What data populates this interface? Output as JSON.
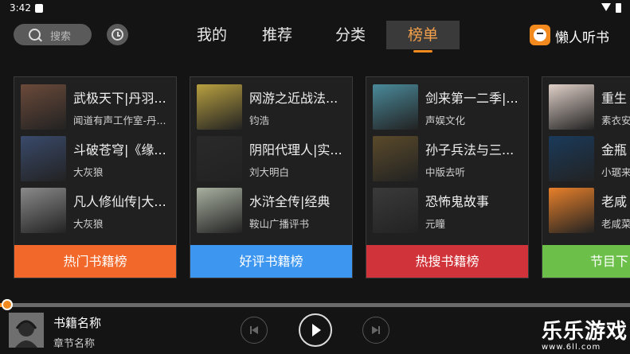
{
  "status_bar": {
    "time": "3:42"
  },
  "header": {
    "search_placeholder": "搜索",
    "tabs": [
      {
        "label": "我的"
      },
      {
        "label": "推荐"
      },
      {
        "label": "分类"
      },
      {
        "label": "榜单",
        "active": true
      }
    ],
    "brand": "懒人听书"
  },
  "cards": [
    {
      "label": "热门书籍榜",
      "color": "#f2682a",
      "items": [
        {
          "title": "武极天下|丹羽...",
          "author": "闻道有声工作室-丹...",
          "cover": "#6b4a3a"
        },
        {
          "title": "斗破苍穹|《缘...",
          "author": "大灰狼",
          "cover": "#3a4a6b"
        },
        {
          "title": "凡人修仙传|大...",
          "author": "大灰狼",
          "cover": "#8a8a8a"
        }
      ]
    },
    {
      "label": "好评书籍榜",
      "color": "#3d97f0",
      "items": [
        {
          "title": "网游之近战法...",
          "author": "钧浩",
          "cover": "#b8a040"
        },
        {
          "title": "阴阳代理人|实...",
          "author": "刘大明白",
          "cover": "#2a2a2a"
        },
        {
          "title": "水浒全传|经典",
          "author": "鞍山广播评书",
          "cover": "#a8b0a0"
        }
      ]
    },
    {
      "label": "热搜书籍榜",
      "color": "#d0343a",
      "items": [
        {
          "title": "剑来第一二季|...",
          "author": "声娱文化",
          "cover": "#4a8a9a"
        },
        {
          "title": "孙子兵法与三...",
          "author": "中版去听",
          "cover": "#5a4a2a"
        },
        {
          "title": "恐怖鬼故事",
          "author": "元瞳",
          "cover": "#3a3a3a"
        }
      ]
    },
    {
      "label": "节目下",
      "color": "#6cc04a",
      "items": [
        {
          "title": "重生",
          "author": "素衣安",
          "cover": "#e0d0c8"
        },
        {
          "title": "金瓶",
          "author": "小琚来",
          "cover": "#1a3a5a"
        },
        {
          "title": "老咸",
          "author": "老咸菜",
          "cover": "#e8802a"
        }
      ]
    }
  ],
  "player": {
    "book_title": "书籍名称",
    "chapter": "章节名称",
    "progress": 0.01,
    "accent": "#f28a1e"
  },
  "watermark": {
    "name": "乐乐游戏",
    "url": "www.6ll.com"
  }
}
